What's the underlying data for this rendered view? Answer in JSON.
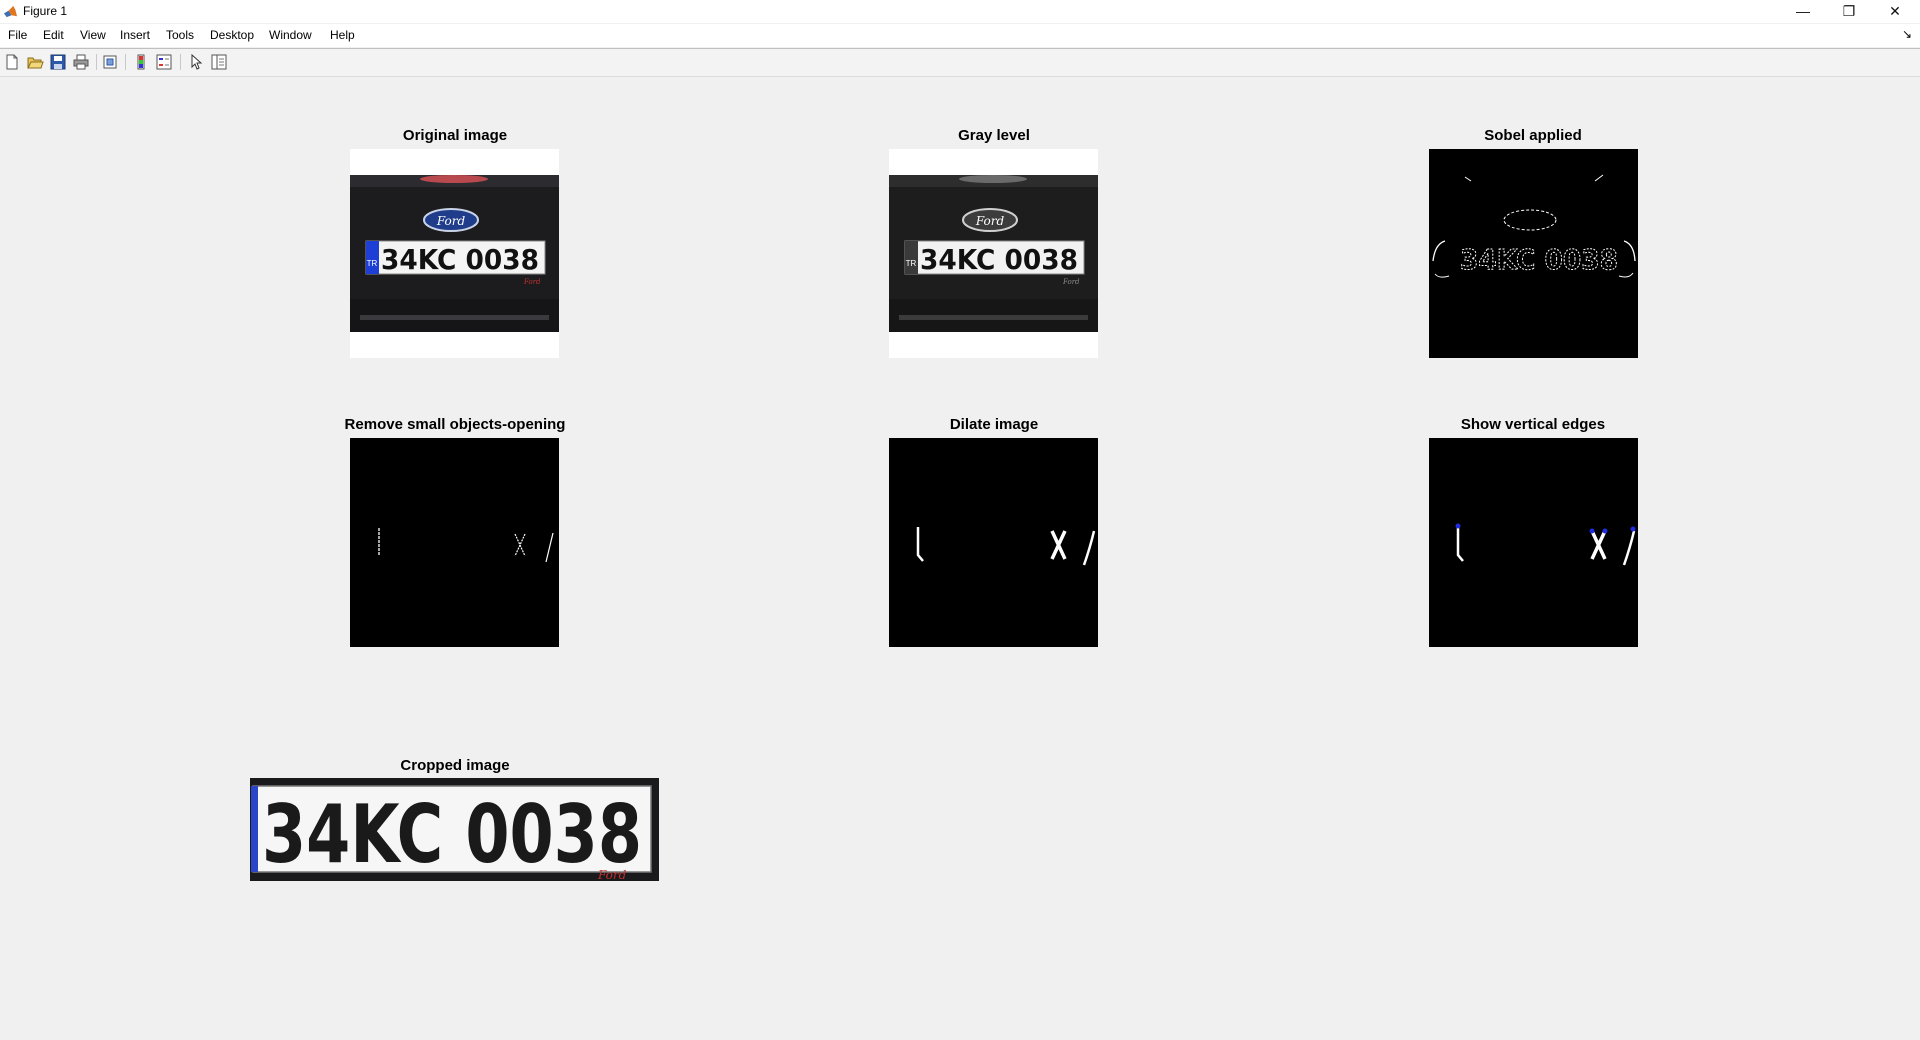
{
  "window": {
    "title": "Figure 1",
    "icon": "matlab-icon",
    "controls": [
      "minimize-icon",
      "restore-icon",
      "close-icon"
    ]
  },
  "menu": {
    "items": [
      "File",
      "Edit",
      "View",
      "Insert",
      "Tools",
      "Desktop",
      "Window",
      "Help"
    ]
  },
  "toolbar": {
    "buttons": [
      "new-figure-icon",
      "open-file-icon",
      "save-icon",
      "print-icon",
      "link-plot-icon",
      "insert-colorbar-icon",
      "insert-legend-icon",
      "edit-plot-icon",
      "property-inspector-icon"
    ]
  },
  "plate": {
    "text": "34KC 0038",
    "country_code": "TR",
    "brand": "Ford"
  },
  "subplots": [
    {
      "title": "Original image"
    },
    {
      "title": "Gray level"
    },
    {
      "title": "Sobel applied"
    },
    {
      "title": "Remove small objects-opening"
    },
    {
      "title": "Dilate image"
    },
    {
      "title": "Show vertical edges"
    },
    {
      "title": "Cropped image"
    }
  ],
  "colors": {
    "background": "#f0f0f0",
    "eu_band": "#1e3fd6",
    "marker": "#1f2ce0"
  }
}
